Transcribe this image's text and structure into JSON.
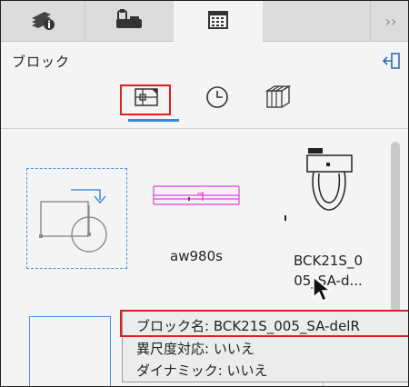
{
  "tabs": [
    {
      "icon": "layers-info-icon"
    },
    {
      "icon": "scanner-icon"
    },
    {
      "icon": "block-library-icon",
      "active": true
    },
    {
      "label": "››"
    }
  ],
  "panel": {
    "title": "ブロック"
  },
  "view_modes": [
    {
      "icon": "block-view-icon",
      "selected": true
    },
    {
      "icon": "recent-clock-icon"
    },
    {
      "icon": "catalog-books-icon"
    }
  ],
  "blocks": [
    {
      "label": "",
      "icon": "insert-block-icon"
    },
    {
      "label": "aw980s"
    },
    {
      "label_line1": "BCK21S_0",
      "label_line2": "05_SA-d..."
    }
  ],
  "tooltip": {
    "line1": "ブロック名: BCK21S_005_SA-delR",
    "line2": "異尺度対応: いいえ",
    "line3": "ダイナミック: いいえ"
  },
  "colors": {
    "accent": "#2f8de0",
    "highlight": "#e02020",
    "magenta": "#e040e0"
  }
}
